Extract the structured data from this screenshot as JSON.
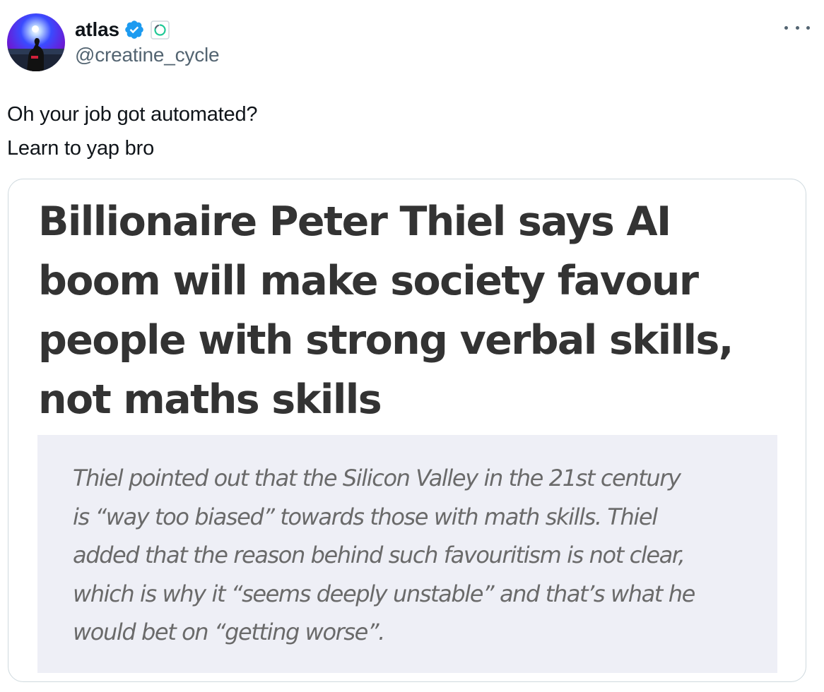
{
  "author": {
    "display_name": "atlas",
    "handle": "@creatine_cycle",
    "verified_icon": "verified-badge-icon",
    "affiliate_icon": "affiliate-badge-icon",
    "avatar": "profile-photo"
  },
  "menu": {
    "more_icon": "more-options-icon"
  },
  "tweet": {
    "lines": [
      "Oh your job got automated?",
      "Learn to yap bro"
    ]
  },
  "media": {
    "headline_lines": [
      "Billionaire Peter Thiel says AI",
      "boom will make society favour",
      "people with strong verbal skills,",
      "not maths skills"
    ],
    "quote_lines": [
      "Thiel pointed out that the Silicon Valley in the 21st century",
      "is “way too biased” towards those with math skills. Thiel",
      "added that the reason behind such favouritism is not clear,",
      "which is why it “seems deeply unstable” and that’s what he",
      "would bet on “getting worse”."
    ]
  },
  "colors": {
    "verified_blue": "#1d9bf0",
    "secondary_text": "#536471",
    "card_border": "#cfd9de",
    "headline_text": "#333333",
    "quote_background": "#eeeff6",
    "quote_text": "#6a6a6a"
  }
}
